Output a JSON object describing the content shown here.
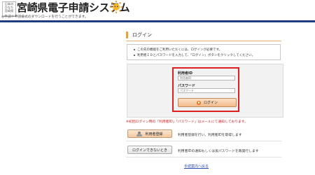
{
  "header": {
    "badge_lines": [
      "日本の",
      "ひなた",
      "宮崎県"
    ],
    "site_title": "宮崎県電子申請システム",
    "subline": "◎申請や申請様式のダウンロードを行うことができます。"
  },
  "section": {
    "title": "ログイン"
  },
  "notice": {
    "line1": "この先の機能をご利用いただくには、ログインが必要です。",
    "line2": "利用者ＩＤとパスワードを入力して、「ログイン」ボタンをクリックしてください。"
  },
  "login": {
    "id_label": "利用者ID",
    "id_placeholder": "利用者ID",
    "password_label": "パスワード",
    "password_placeholder": "パスワード",
    "button_label": "ログイン"
  },
  "red_note": "※初回ログイン時の「利用者ID」「パスワード」はメールにて通知しております。",
  "actions": [
    {
      "button_label": "利用者登録",
      "description": "利用者登録を行い、利用者IDを取得します"
    },
    {
      "button_label": "ログインできないとき",
      "description": "利用者IDの通知もしくは仮パスワードを再発行します"
    }
  ],
  "back_link": "手続案内へ戻る",
  "colors": {
    "header_rule": "#1f3b82",
    "accent_orange": "#f0a030",
    "highlight_red": "#e02020",
    "link_blue": "#2a4fb0"
  }
}
